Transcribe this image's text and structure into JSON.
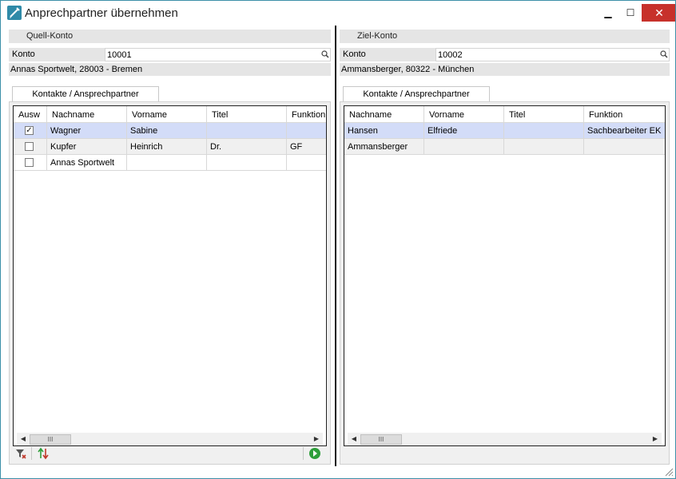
{
  "window": {
    "title": "Anprechpartner übernehmen",
    "minimize": "▁",
    "maximize": "☐",
    "close": "✕"
  },
  "source": {
    "header": "Quell-Konto",
    "konto_label": "Konto",
    "konto_value": "10001",
    "address": "Annas Sportwelt, 28003 - Bremen",
    "tab_label": "Kontakte / Ansprechpartner",
    "columns": [
      "Ausw",
      "Nachname",
      "Vorname",
      "Titel",
      "Funktion"
    ],
    "rows": [
      {
        "checked": true,
        "nachname": "Wagner",
        "vorname": "Sabine",
        "titel": "",
        "funktion": ""
      },
      {
        "checked": false,
        "nachname": "Kupfer",
        "vorname": "Heinrich",
        "titel": "Dr.",
        "funktion": "GF"
      },
      {
        "checked": false,
        "nachname": "Annas Sportwelt",
        "vorname": "",
        "titel": "",
        "funktion": ""
      }
    ],
    "scroll_thumb": "III"
  },
  "target": {
    "header": "Ziel-Konto",
    "konto_label": "Konto",
    "konto_value": "10002",
    "address": "Ammansberger, 80322 - München",
    "tab_label": "Kontakte / Ansprechpartner",
    "columns": [
      "Nachname",
      "Vorname",
      "Titel",
      "Funktion"
    ],
    "rows": [
      {
        "nachname": "Hansen",
        "vorname": "Elfriede",
        "titel": "",
        "funktion": "Sachbearbeiter EK"
      },
      {
        "nachname": "Ammansberger",
        "vorname": "",
        "titel": "",
        "funktion": ""
      }
    ],
    "scroll_thumb": "III"
  },
  "colors": {
    "accent": "#3c8fa8",
    "selection": "#d3dcf8",
    "panel_gray": "#e5e5e5",
    "close_red": "#c7312b",
    "go_green": "#2e9e3a"
  },
  "icons": {
    "app": "compass-pen-icon",
    "search": "magnifier-icon",
    "clear_filter": "filter-clear-icon",
    "swap": "swap-arrows-icon",
    "go": "green-go-icon"
  }
}
